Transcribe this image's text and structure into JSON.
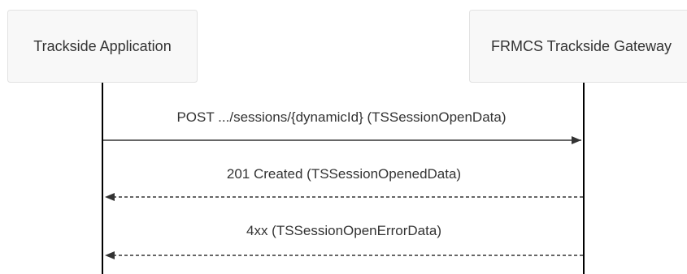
{
  "diagram": {
    "type": "sequence",
    "actors": [
      {
        "id": "app",
        "label": "Trackside Application"
      },
      {
        "id": "gw",
        "label": "FRMCS Trackside Gateway"
      }
    ],
    "messages": [
      {
        "from": "app",
        "to": "gw",
        "label": "POST .../sessions/{dynamicId} (TSSessionOpenData)",
        "style": "solid"
      },
      {
        "from": "gw",
        "to": "app",
        "label": "201 Created (TSSessionOpenedData)",
        "style": "dashed"
      },
      {
        "from": "gw",
        "to": "app",
        "label": "4xx (TSSessionOpenErrorData)",
        "style": "dashed"
      }
    ],
    "colors": {
      "actor_fill": "#f8f8f8",
      "actor_border": "#e2e2e2",
      "lifeline": "#000000",
      "message": "#333333",
      "text": "#333333"
    }
  }
}
